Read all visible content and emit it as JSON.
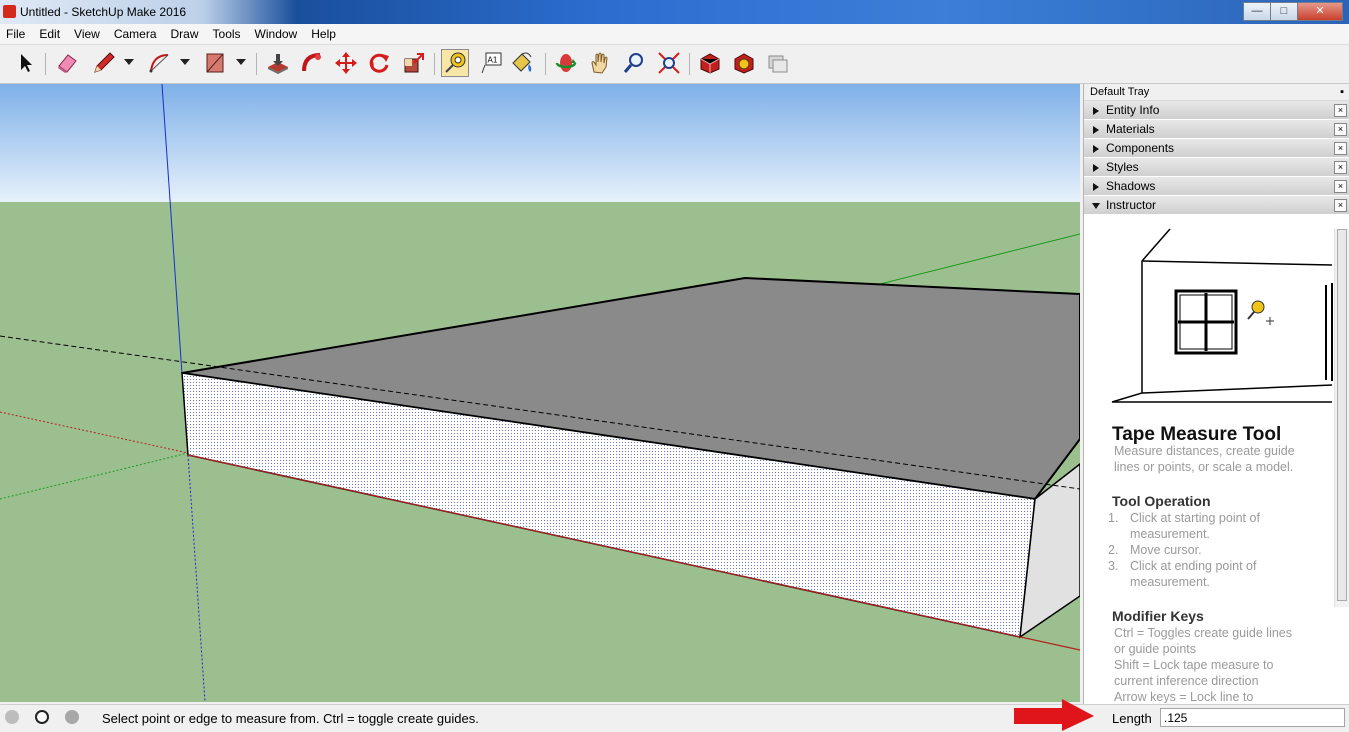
{
  "window": {
    "title": "Untitled - SketchUp Make 2016",
    "min": "—",
    "max": "□",
    "close": "✕"
  },
  "menu": [
    "File",
    "Edit",
    "View",
    "Camera",
    "Draw",
    "Tools",
    "Window",
    "Help"
  ],
  "toolbar": {
    "tools": [
      "select-icon",
      "eraser-icon",
      "pencil-icon",
      "arc-icon",
      "rectangle-icon",
      "push-pull-icon",
      "follow-me-icon",
      "move-icon",
      "rotate-icon",
      "scale-icon",
      "tape-measure-icon",
      "text-icon",
      "paint-bucket-icon",
      "orbit-icon",
      "pan-icon",
      "zoom-icon",
      "zoom-extents-icon",
      "warehouse-icon",
      "extension-warehouse-icon",
      "share-model-icon"
    ],
    "active": "tape-measure-icon",
    "text_tool_label": "A1"
  },
  "tray": {
    "title": "Default Tray",
    "panels": [
      {
        "label": "Entity Info",
        "expanded": false
      },
      {
        "label": "Materials",
        "expanded": false
      },
      {
        "label": "Components",
        "expanded": false
      },
      {
        "label": "Styles",
        "expanded": false
      },
      {
        "label": "Shadows",
        "expanded": false
      },
      {
        "label": "Instructor",
        "expanded": true
      }
    ],
    "instructor": {
      "title": "Tape Measure Tool",
      "desc": [
        "Measure distances, create guide",
        "lines or points, or scale a model."
      ],
      "op_heading": "Tool Operation",
      "ops": [
        {
          "num": "1.",
          "lines": [
            "Click at starting point of",
            "measurement."
          ]
        },
        {
          "num": "2.",
          "lines": [
            "Move cursor."
          ]
        },
        {
          "num": "3.",
          "lines": [
            "Click at ending point of",
            "measurement."
          ]
        }
      ],
      "mod_heading": "Modifier Keys",
      "mods": [
        "Ctrl = Toggles create guide lines",
        "or guide points",
        "Shift = Lock tape measure to",
        "current inference direction",
        "Arrow keys = Lock line to"
      ]
    }
  },
  "status": {
    "message": "Select point or edge to measure from.  Ctrl = toggle create guides.",
    "measure_label": "Length",
    "measure_value": ".125"
  },
  "colors": {
    "sky_top": "#7fb0e8",
    "sky_bottom": "#e6f1fb",
    "ground": "#9cbf8f",
    "top_face": "#8a8a8a",
    "annotation_arrow": "#e0141b"
  }
}
